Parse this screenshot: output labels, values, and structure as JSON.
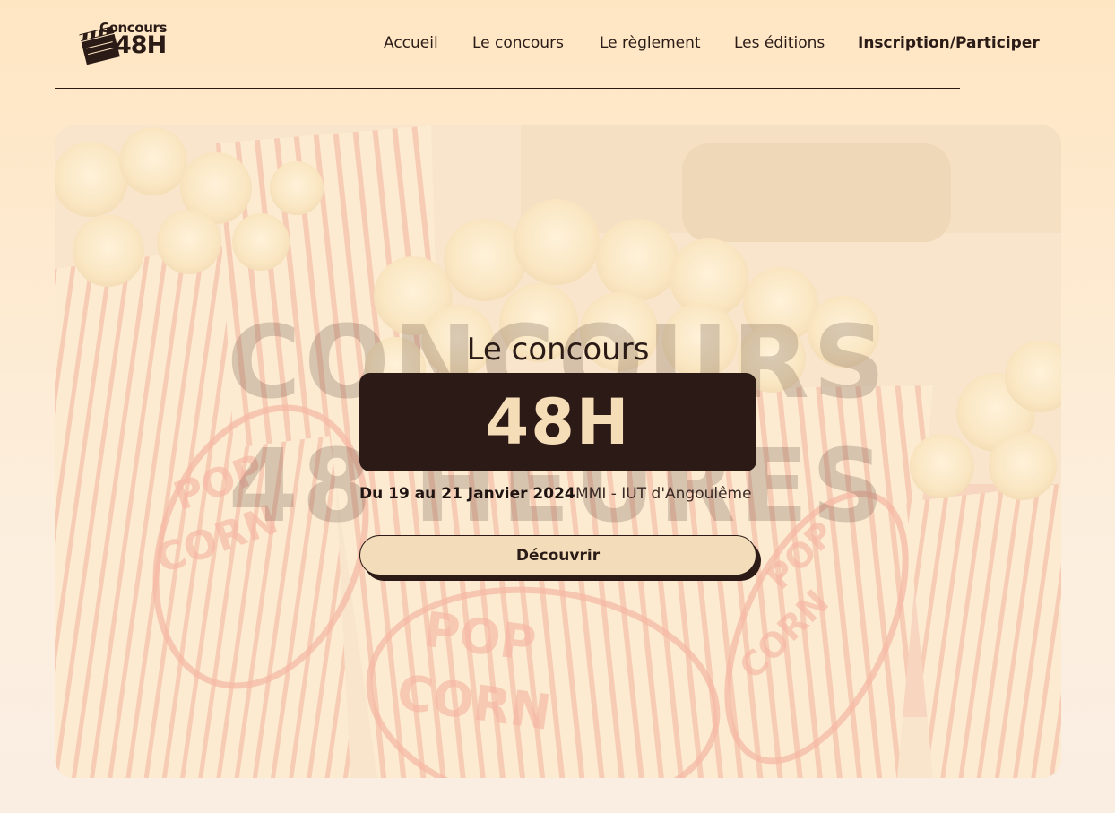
{
  "logo": {
    "line1": "Concours",
    "line2": "48H"
  },
  "nav": {
    "items": [
      {
        "label": "Accueil"
      },
      {
        "label": "Le concours"
      },
      {
        "label": "Le règlement"
      },
      {
        "label": "Les éditions"
      },
      {
        "label": "Inscription/Participer"
      }
    ]
  },
  "hero": {
    "watermark_line1": "CONCOURS",
    "watermark_line2": "48 HEURES",
    "subtitle": "Le concours",
    "title": "48H",
    "date": "Du 19 au 21 Janvier 2024",
    "location": "MMI - IUT d'Angoulême",
    "cta_label": "Découvrir",
    "background_image": "popcorn-boxes-photo"
  },
  "colors": {
    "background_top": "#ffe6c3",
    "background_bottom": "#faeee3",
    "dark": "#2c1a17",
    "cream": "#f2dcb9",
    "popcorn_stripe": "#e8786a"
  }
}
